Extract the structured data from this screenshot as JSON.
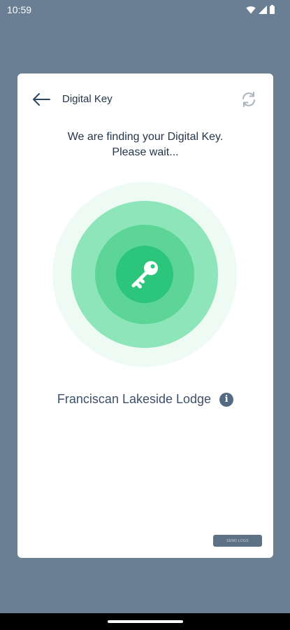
{
  "status_bar": {
    "time": "10:59",
    "icons": [
      "wifi-icon",
      "signal-icon",
      "battery-icon"
    ]
  },
  "header": {
    "title": "Digital Key",
    "back_icon": "arrow-left-icon",
    "refresh_icon": "refresh-icon"
  },
  "message": {
    "line1": "We are finding your Digital Key.",
    "line2": "Please wait..."
  },
  "property": {
    "name": "Franciscan Lakeside Lodge",
    "info_glyph": "i"
  },
  "actions": {
    "send_logs_label": "SEND LOGS"
  },
  "colors": {
    "background": "#6b7f94",
    "card": "#ffffff",
    "accent_green": "#2cc57c",
    "text_dark": "#24364a"
  }
}
